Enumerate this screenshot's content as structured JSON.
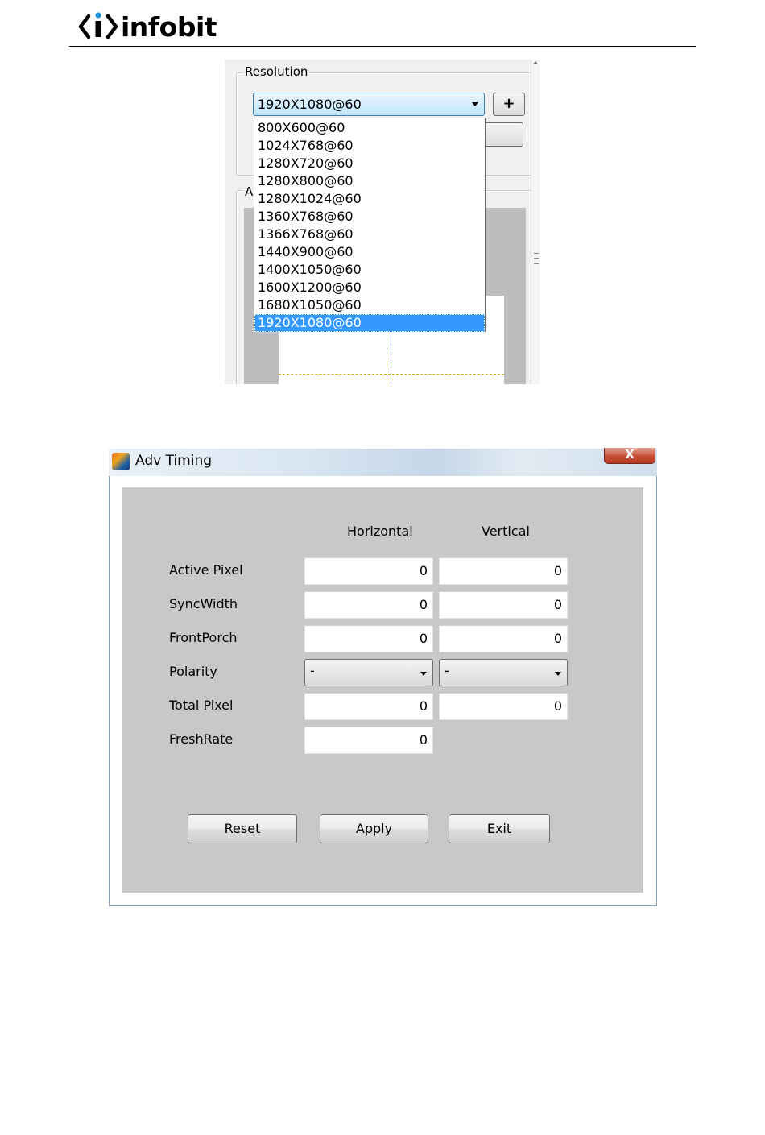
{
  "header": {
    "logo_text": "infobit"
  },
  "resolution_panel": {
    "group_title": "Resolution",
    "group2_title_partial": "A",
    "combo_value": "1920X1080@60",
    "add_button_label": "+",
    "options": [
      "800X600@60",
      "1024X768@60",
      "1280X720@60",
      "1280X800@60",
      "1280X1024@60",
      "1360X768@60",
      "1366X768@60",
      "1440X900@60",
      "1400X1050@60",
      "1600X1200@60",
      "1680X1050@60",
      "1920X1080@60"
    ],
    "selected_option": "1920X1080@60"
  },
  "adv_timing": {
    "title": "Adv Timing",
    "close_label": "X",
    "col_horizontal": "Horizontal",
    "col_vertical": "Vertical",
    "rows": {
      "active_pixel": {
        "label": "Active Pixel",
        "h": "0",
        "v": "0"
      },
      "sync_width": {
        "label": "SyncWidth",
        "h": "0",
        "v": "0"
      },
      "front_porch": {
        "label": "FrontPorch",
        "h": "0",
        "v": "0"
      },
      "polarity": {
        "label": "Polarity",
        "h": "-",
        "v": "-"
      },
      "total_pixel": {
        "label": "Total Pixel",
        "h": "0",
        "v": "0"
      },
      "fresh_rate": {
        "label": "FreshRate",
        "h": "0"
      }
    },
    "buttons": {
      "reset": "Reset",
      "apply": "Apply",
      "exit": "Exit"
    }
  }
}
